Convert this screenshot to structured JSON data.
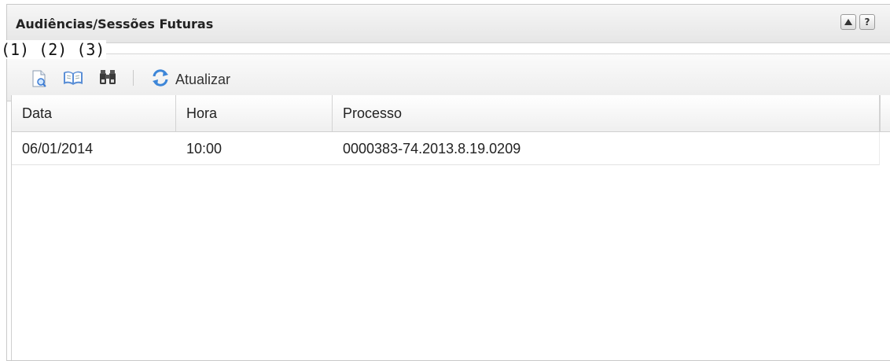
{
  "panel": {
    "title": "Audiências/Sessões Futuras",
    "collapse_icon": "caret-up-icon",
    "help_label": "?"
  },
  "annotations": "(1) (2) (3)",
  "toolbar": {
    "icons": [
      "document-search-icon",
      "open-book-icon",
      "binoculars-icon"
    ],
    "refresh_icon": "refresh-icon",
    "refresh_label": "Atualizar"
  },
  "table": {
    "columns": [
      "Data",
      "Hora",
      "Processo"
    ],
    "rows": [
      [
        "06/01/2014",
        "10:00",
        "0000383-74.2013.8.19.0209"
      ]
    ]
  }
}
